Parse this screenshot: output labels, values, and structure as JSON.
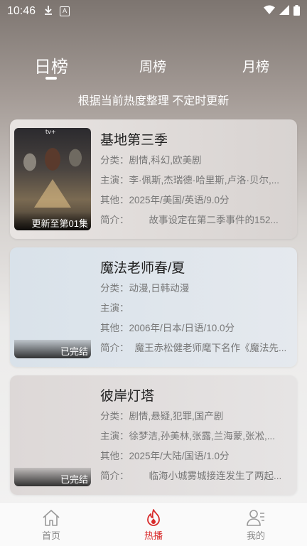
{
  "status_bar": {
    "time": "10:46"
  },
  "tabs": [
    {
      "label": "日榜",
      "active": true
    },
    {
      "label": "周榜",
      "active": false
    },
    {
      "label": "月榜",
      "active": false
    }
  ],
  "subtitle": "根据当前热度整理 不定时更新",
  "shows": [
    {
      "title": "基地第三季",
      "genre_label": "分类：",
      "genre": "剧情,科幻,欧美剧",
      "cast_label": "主演：",
      "cast": "李·佩斯,杰瑞德·哈里斯,卢洛·贝尔,...",
      "other_label": "其他：",
      "other": "2025年/美国/英语/9.0分",
      "intro_label": "简介：",
      "intro": "故事设定在第二季事件的152...",
      "poster_label": "更新至第01集"
    },
    {
      "title": "魔法老师春/夏",
      "genre_label": "分类：",
      "genre": "动漫,日韩动漫",
      "cast_label": "主演：",
      "cast": "",
      "other_label": "其他：",
      "other": "2006年/日本/日语/10.0分",
      "intro_label": "简介：",
      "intro": "魔王赤松健老师麾下名作《魔法先...",
      "poster_label": "已完结"
    },
    {
      "title": "彼岸灯塔",
      "genre_label": "分类：",
      "genre": "剧情,悬疑,犯罪,国产剧",
      "cast_label": "主演：",
      "cast": "徐梦洁,孙美林,张露,兰海蒙,张凇,...",
      "other_label": "其他：",
      "other": "2025年/大陆/国语/1.0分",
      "intro_label": "简介：",
      "intro": "临海小城雾城接连发生了两起...",
      "poster_label": "已完结"
    }
  ],
  "bottom_nav": [
    {
      "label": "首页",
      "icon": "home-icon",
      "active": false
    },
    {
      "label": "热播",
      "icon": "flame-icon",
      "active": true
    },
    {
      "label": "我的",
      "icon": "user-icon",
      "active": false
    }
  ],
  "colors": {
    "accent": "#d82a2a",
    "inactive": "#888888"
  }
}
